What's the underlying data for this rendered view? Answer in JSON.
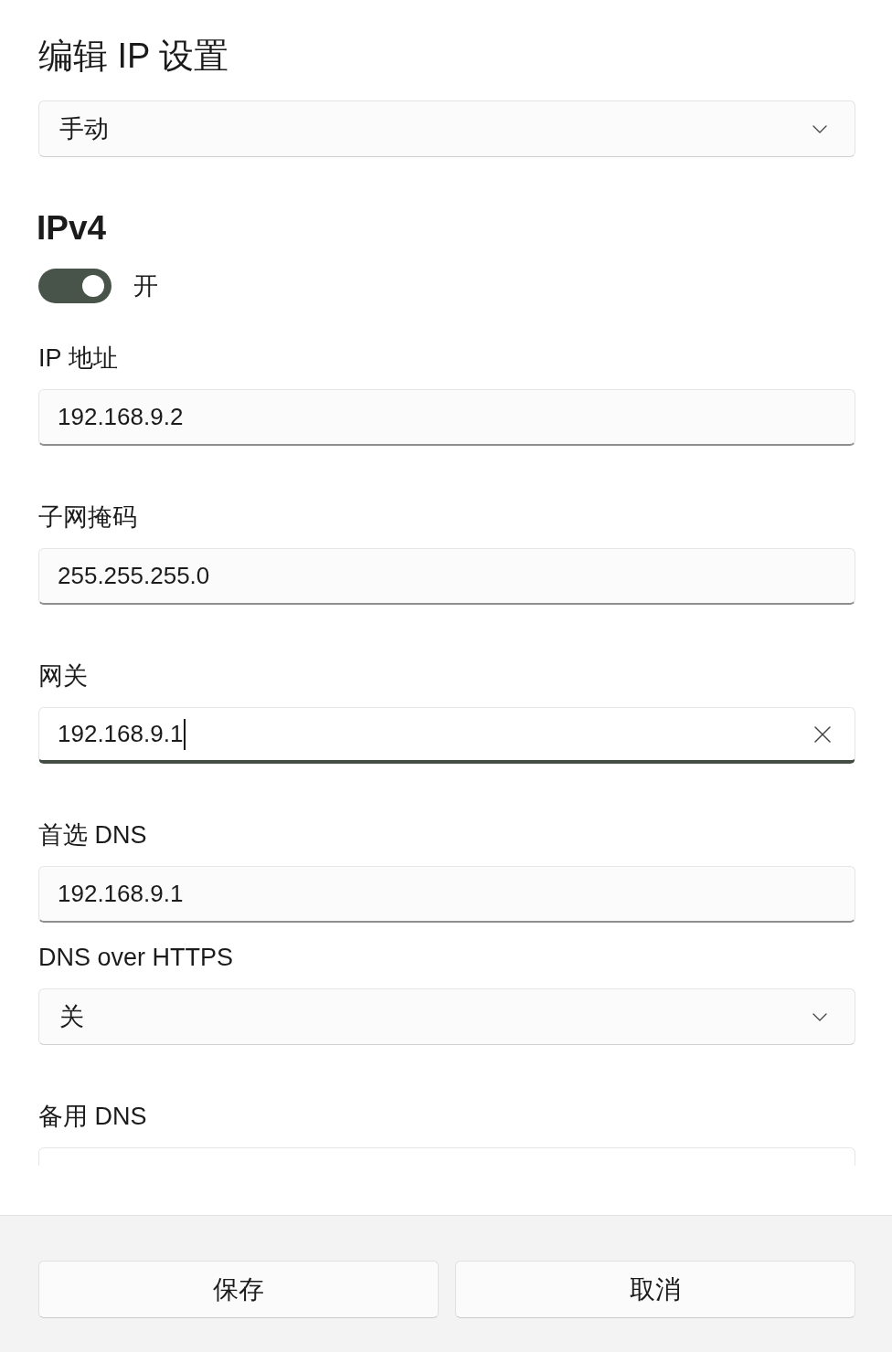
{
  "dialog": {
    "title": "编辑 IP 设置"
  },
  "mode_select": {
    "value": "手动"
  },
  "ipv4": {
    "heading": "IPv4",
    "toggle": {
      "on": true,
      "label": "开"
    }
  },
  "fields": [
    {
      "kind": "text",
      "label": "IP 地址",
      "value": "192.168.9.2",
      "focused": false
    },
    {
      "kind": "text",
      "label": "子网掩码",
      "value": "255.255.255.0",
      "focused": false
    },
    {
      "kind": "text",
      "label": "网关",
      "value": "192.168.9.1",
      "focused": true
    },
    {
      "kind": "text",
      "label": "首选 DNS",
      "value": "192.168.9.1",
      "focused": false
    },
    {
      "kind": "select",
      "label": "DNS over HTTPS",
      "value": "关"
    },
    {
      "kind": "cutoff",
      "label": "备用 DNS"
    }
  ],
  "buttons": [
    "保存",
    "取消"
  ]
}
